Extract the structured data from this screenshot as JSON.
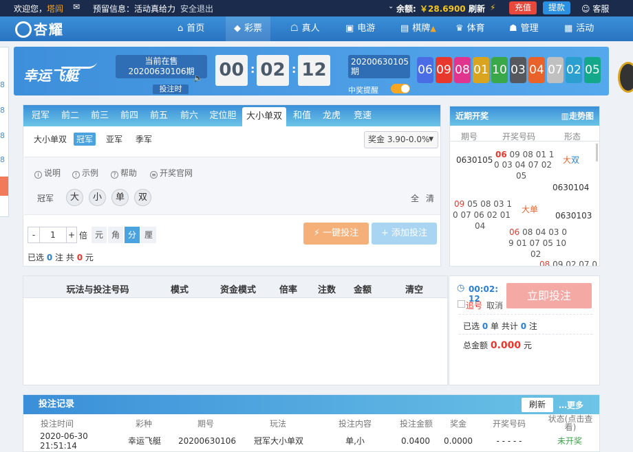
{
  "topbar": {
    "welcome": "欢迎您，",
    "username": "塔闾",
    "notice_label": "预留信息：",
    "notice": "活动真给力",
    "logout": "安全退出",
    "balance_label": "余额:",
    "balance": "￥28.6900",
    "refresh": "刷新",
    "recharge": "充值",
    "withdraw": "提款",
    "service": "客服"
  },
  "nav": {
    "logo": "杏耀",
    "items": [
      {
        "label": "首页",
        "icon": "home-icon"
      },
      {
        "label": "彩票",
        "icon": "lottery-icon"
      },
      {
        "label": "真人",
        "icon": "live-icon"
      },
      {
        "label": "电游",
        "icon": "slots-icon"
      },
      {
        "label": "棋牌",
        "icon": "cards-icon"
      },
      {
        "label": "体育",
        "icon": "sports-icon"
      },
      {
        "label": "管理",
        "icon": "manage-icon"
      },
      {
        "label": "活动",
        "icon": "gift-icon"
      }
    ]
  },
  "side_stub": [
    "8",
    "8",
    "8",
    "8"
  ],
  "header": {
    "game_name": "幸运飞艇",
    "current_label": "当前在售",
    "current_issue": "20200630106期",
    "bet_time": "投注时",
    "timer": {
      "h": "00",
      "m": "02",
      "s": "12"
    },
    "prev_issue": "20200630105期",
    "win_notice": "中奖提醒",
    "balls": [
      "06",
      "09",
      "08",
      "01",
      "10",
      "03",
      "04",
      "07",
      "02",
      "05"
    ],
    "ball_colors": [
      "#4a6de5",
      "#e8372c",
      "#e0348e",
      "#d9a520",
      "#3aa848",
      "#55595e",
      "#e8632a",
      "#c0c0c0",
      "#2a9fd0",
      "#14a88a"
    ]
  },
  "tabs": [
    "冠军",
    "前二",
    "前三",
    "前四",
    "前五",
    "前六",
    "定位胆",
    "大小单双",
    "和值",
    "龙虎",
    "竞速"
  ],
  "subtabs": [
    "大小单双",
    "冠军",
    "亚军",
    "季军"
  ],
  "odds": "奖金 3.90-0.0%",
  "help": [
    "说明",
    "示例",
    "帮助",
    "开奖官网"
  ],
  "pick": {
    "row_label": "冠军",
    "options": [
      "大",
      "小",
      "单",
      "双"
    ],
    "all": "全",
    "clear": "清"
  },
  "bet": {
    "minus": "-",
    "multiplier": "1",
    "plus": "+",
    "times": "倍",
    "units": [
      "元",
      "角",
      "分",
      "厘"
    ],
    "active_unit": "分",
    "quick_bet": "一键投注",
    "add_bet": "添加投注",
    "selected_prefix": "已选",
    "selected_count": "0",
    "selected_unit": "注",
    "total_prefix": "共",
    "total": "0",
    "total_unit": "元"
  },
  "recent": {
    "title": "近期开奖",
    "trend": "走势图",
    "cols": [
      "期号",
      "开奖号码",
      "形态"
    ],
    "rows": [
      {
        "issue": "0630105",
        "nums_first": "06",
        "nums_rest": "09 08 01 1",
        "line2": "0 03 04 07 02",
        "line3": "05",
        "form_a": "大",
        "form_b": "双"
      },
      {
        "issue": "0630104",
        "nums_first": "",
        "nums_rest": "",
        "line2": "",
        "line3": "",
        "form_a": "",
        "form_b": ""
      },
      {
        "issue": "0630103",
        "nums_first": "09",
        "nums_rest": "05 08 03 1",
        "line2": "0 07 06 02 01",
        "line3": "04",
        "form_a": "大",
        "form_b": "单"
      },
      {
        "issue": "",
        "nums_first": "06",
        "nums_rest": "08 04 03 0",
        "line2": "9 01 07 05 10",
        "line3": "02",
        "form_a": "",
        "form_b": ""
      },
      {
        "issue": "",
        "nums_first": "08",
        "nums_rest": "09 02 07 0",
        "line2": "",
        "line3": "",
        "form_a": "",
        "form_b": ""
      }
    ]
  },
  "table": {
    "headers": [
      "玩法与投注号码",
      "模式",
      "资金模式",
      "倍率",
      "注数",
      "金额",
      "清空"
    ]
  },
  "side": {
    "timer": "00:02:",
    "timer2": "12",
    "chase": "追号",
    "cancel": "取消",
    "submit": "立即投注",
    "sel_prefix": "已选",
    "sel_count": "0",
    "sel_mid": "单 共计",
    "sel_notes": "0",
    "sel_unit": "注",
    "total_label": "总金额",
    "total": "0.000",
    "total_unit": "元"
  },
  "records": {
    "title": "投注记录",
    "refresh": "刷新",
    "more": "…更多",
    "headers": [
      "投注时间",
      "彩种",
      "期号",
      "玩法",
      "投注内容",
      "投注金额",
      "奖金",
      "开奖号码",
      "状态(点击查看)"
    ],
    "row": {
      "time": "2020-06-30 21:51:14",
      "game": "幸运飞艇",
      "issue": "20200630106",
      "play": "冠军大小单双",
      "content": "单,小",
      "amount": "0.0400",
      "prize": "0.0000",
      "draw": "- - - - -",
      "status": "未开奖"
    }
  }
}
